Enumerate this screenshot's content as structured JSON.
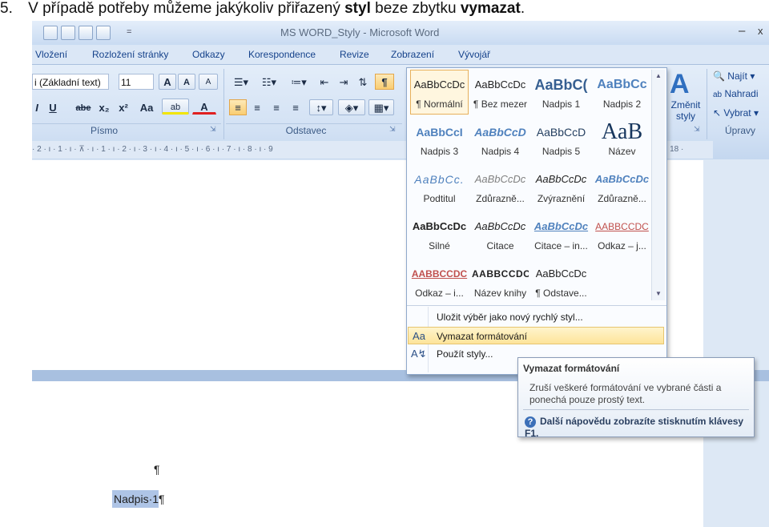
{
  "caption": {
    "number": "5.",
    "text_before": "V případě potřeby můžeme jakýkoliv přiřazený ",
    "bold1": "styl",
    "text_middle": " beze zbytku ",
    "bold2": "vymazat",
    "text_end": "."
  },
  "window": {
    "title": "MS WORD_Styly - Microsoft Word",
    "minimize": "–",
    "close": "x"
  },
  "quick_access": {
    "customize": "="
  },
  "tabs": [
    "Vložení",
    "Rozložení stránky",
    "Odkazy",
    "Korespondence",
    "Revize",
    "Zobrazení",
    "Vývojář"
  ],
  "font_group": {
    "font_name": "i (Základní text)",
    "font_size": "11",
    "grow": "A",
    "shrink": "A",
    "italic": "I",
    "underline": "U",
    "strike": "abe",
    "subscript": "x₂",
    "superscript": "x²",
    "change_case": "Aa",
    "highlight": "ab",
    "font_color": "A",
    "label": "Písmo"
  },
  "paragraph_group": {
    "label": "Odstavec",
    "show_marks": "¶"
  },
  "styles_group": {
    "change_styles": "Změnit styly",
    "big_icon": "A"
  },
  "editing_group": {
    "find": "Najít",
    "replace": "Nahradi",
    "select": "Vybrat",
    "label": "Úpravy"
  },
  "ruler": {
    "marks": "· 2 · ı · 1 · ı · ⊼ · ı · 1 · ı · 2 · ı · 3 · ı · 4 · ı · 5 · ı · 6 · ı · 7 · ı · 8 · ı · 9",
    "marks_right": "· 18 ·"
  },
  "gallery": {
    "rows": [
      [
        {
          "preview": "AaBbCcDc",
          "name": "¶ Normální",
          "style": "normal",
          "active": true
        },
        {
          "preview": "AaBbCcDc",
          "name": "¶ Bez mezer",
          "style": "normal"
        },
        {
          "preview": "AaBbC(",
          "name": "Nadpis 1",
          "style": "h1"
        },
        {
          "preview": "AaBbCc",
          "name": "Nadpis 2",
          "style": "h2"
        }
      ],
      [
        {
          "preview": "AaBbCcI",
          "name": "Nadpis 3",
          "style": "h3"
        },
        {
          "preview": "AaBbCcD",
          "name": "Nadpis 4",
          "style": "h4"
        },
        {
          "preview": "AaBbCcD",
          "name": "Nadpis 5",
          "style": "h5"
        },
        {
          "preview": "AaB",
          "name": "Název",
          "style": "title"
        }
      ],
      [
        {
          "preview": "AaBbCc.",
          "name": "Podtitul",
          "style": "subtitle"
        },
        {
          "preview": "AaBbCcDc",
          "name": "Zdůrazně...",
          "style": "emph"
        },
        {
          "preview": "AaBbCcDc",
          "name": "Zvýraznění",
          "style": "intense-emph"
        },
        {
          "preview": "AaBbCcDc",
          "name": "Zdůrazně...",
          "style": "strong-emph"
        }
      ],
      [
        {
          "preview": "AaBbCcDc",
          "name": "Silné",
          "style": "strong"
        },
        {
          "preview": "AaBbCcDc",
          "name": "Citace",
          "style": "quote"
        },
        {
          "preview": "AaBbCcDc",
          "name": "Citace – in...",
          "style": "intense-quote"
        },
        {
          "preview": "AABBCCDC",
          "name": "Odkaz – j...",
          "style": "subtle-ref"
        }
      ],
      [
        {
          "preview": "AABBCCDC",
          "name": "Odkaz – i...",
          "style": "intense-ref"
        },
        {
          "preview": "AABBCCDC",
          "name": "Název knihy",
          "style": "book"
        },
        {
          "preview": "AaBbCcDc",
          "name": "¶ Odstave...",
          "style": "normal"
        }
      ]
    ],
    "menu": [
      {
        "label": "Uložit výběr jako nový rychlý styl...",
        "icon": "",
        "highlighted": false
      },
      {
        "label": "Vymazat formátování",
        "icon": "clear-format-icon",
        "highlighted": true
      },
      {
        "label": "Použít styly...",
        "icon": "apply-styles-icon",
        "highlighted": false
      }
    ]
  },
  "tooltip": {
    "title": "Vymazat formátování",
    "body": "Zruší veškeré formátování ve vybrané části a ponechá pouze prostý text.",
    "help": "Další nápovědu zobrazíte stisknutím klávesy F1."
  },
  "document": {
    "empty_paragraph": "¶",
    "heading_text": "Nadpis·1",
    "heading_mark": "¶"
  },
  "colors": {
    "ribbon_text": "#15428b",
    "highlight": "#fde49a",
    "selection": "#aec4e6",
    "accent_heading": "#365f91"
  }
}
